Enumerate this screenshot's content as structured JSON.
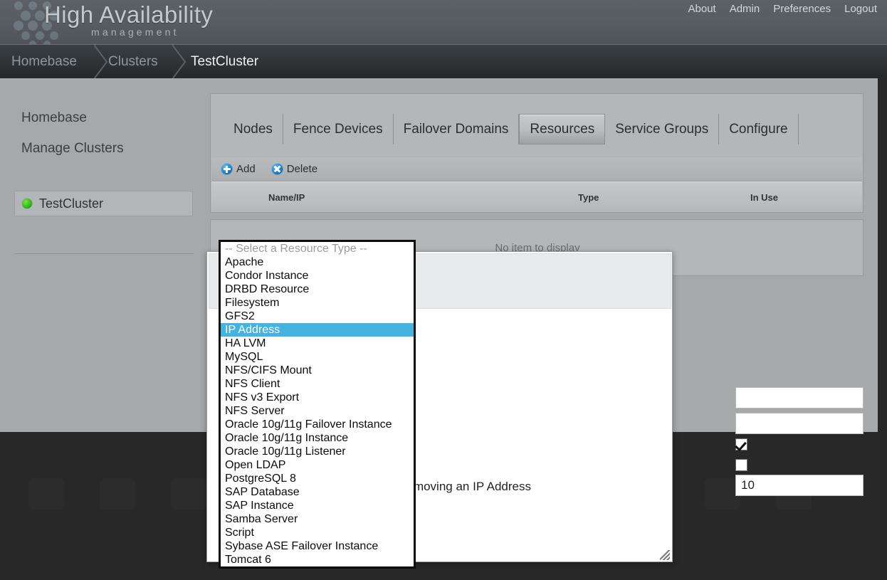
{
  "header": {
    "brand_title": "High Availability",
    "brand_subtitle": "management",
    "logo_icon": "hex-dots-logo",
    "nav": [
      {
        "label": "About",
        "name": "about"
      },
      {
        "label": "Admin",
        "name": "admin"
      },
      {
        "label": "Preferences",
        "name": "preferences"
      },
      {
        "label": "Logout",
        "name": "logout"
      }
    ]
  },
  "breadcrumb": [
    {
      "label": "Homebase",
      "active": false
    },
    {
      "label": "Clusters",
      "active": false
    },
    {
      "label": "TestCluster",
      "active": true
    }
  ],
  "sidebar": {
    "links": [
      {
        "label": "Homebase"
      },
      {
        "label": "Manage Clusters"
      }
    ],
    "cluster": {
      "label": "TestCluster",
      "status_icon": "green-status-dot",
      "status_color": "#2cbf14"
    }
  },
  "panel": {
    "tabs": [
      {
        "label": "Nodes",
        "selected": false
      },
      {
        "label": "Fence Devices",
        "selected": false
      },
      {
        "label": "Failover Domains",
        "selected": false
      },
      {
        "label": "Resources",
        "selected": true
      },
      {
        "label": "Service Groups",
        "selected": false
      },
      {
        "label": "Configure",
        "selected": false
      }
    ],
    "toolbar": {
      "add_label": "Add",
      "add_icon": "plus-circle-icon",
      "delete_label": "Delete",
      "delete_icon": "x-circle-icon"
    },
    "table": {
      "columns": [
        "Name/IP",
        "Type",
        "In Use"
      ],
      "rows": [],
      "empty_message": "No item to display"
    }
  },
  "dialog": {
    "fields": {
      "text1_value": "",
      "text2_value": "",
      "checkbox1_checked": true,
      "checkbox2_checked": false,
      "sleep_label": "moving an IP Address",
      "sleep_value": "10"
    },
    "resize_grip_icon": "resize-grip-icon"
  },
  "resource_type_select": {
    "name": "resource-type-select",
    "selected": "IP Address",
    "options": [
      "-- Select a Resource Type --",
      "Apache",
      "Condor Instance",
      "DRBD Resource",
      "Filesystem",
      "GFS2",
      "IP Address",
      "HA LVM",
      "MySQL",
      "NFS/CIFS Mount",
      "NFS Client",
      "NFS v3 Export",
      "NFS Server",
      "Oracle 10g/11g Failover Instance",
      "Oracle 10g/11g Instance",
      "Oracle 10g/11g Listener",
      "Open LDAP",
      "PostgreSQL 8",
      "SAP Database",
      "SAP Instance",
      "Samba Server",
      "Script",
      "Sybase ASE Failover Instance",
      "Tomcat 6"
    ],
    "highlight_color": "#45b3e0"
  }
}
